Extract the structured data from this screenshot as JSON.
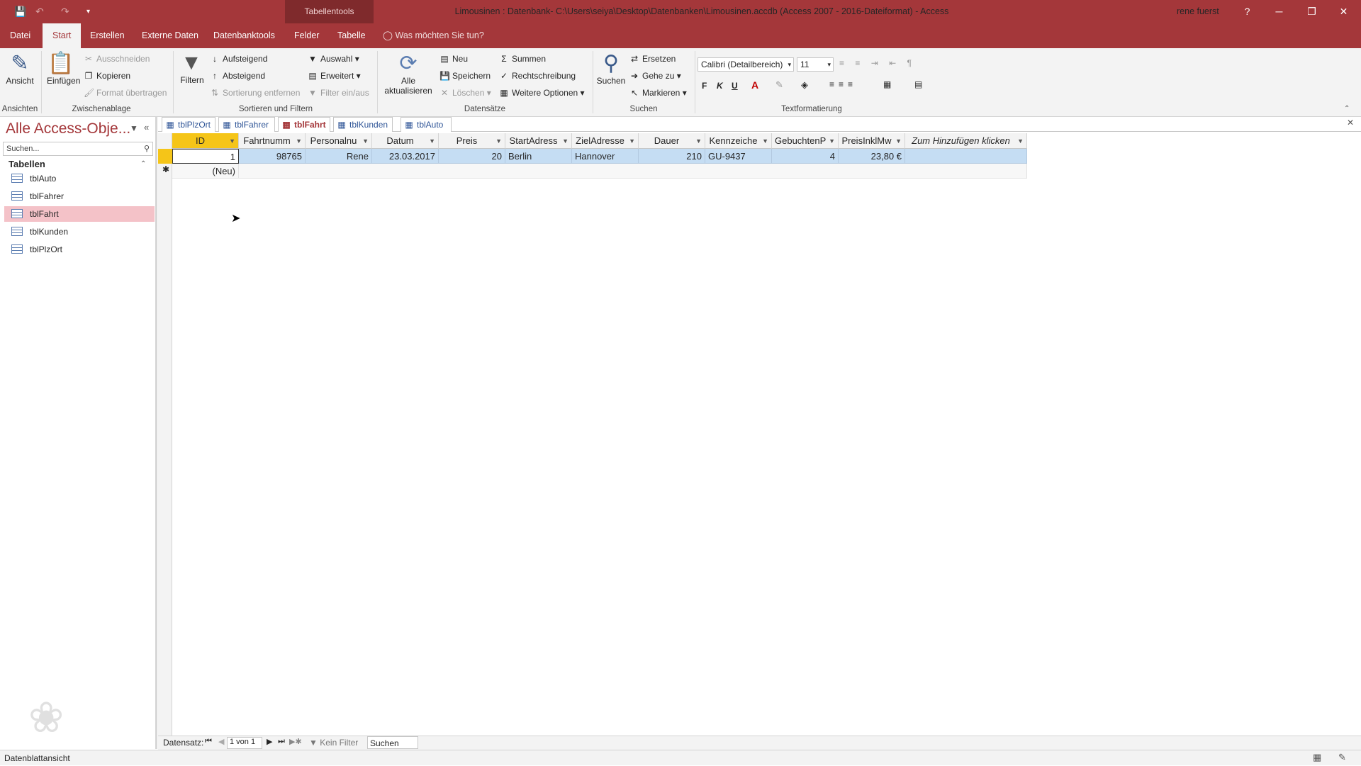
{
  "titlebar": {
    "context_label": "Tabellentools",
    "title": "Limousinen : Datenbank- C:\\Users\\seiya\\Desktop\\Datenbanken\\Limousinen.accdb (Access 2007 - 2016-Dateiformat)  -  Access",
    "user": "rene fuerst",
    "help": "?",
    "minimize": "─",
    "restore": "❐",
    "close": "✕"
  },
  "ribbon_tabs": [
    "Datei",
    "Start",
    "Erstellen",
    "Externe Daten",
    "Datenbanktools",
    "Felder",
    "Tabelle"
  ],
  "tell_me": "Was möchten Sie tun?",
  "ribbon": {
    "ansichten": {
      "label": "Ansichten",
      "ansicht": "Ansicht"
    },
    "zwischenablage": {
      "label": "Zwischenablage",
      "einfuegen": "Einfügen",
      "ausschneiden": "Ausschneiden",
      "kopieren": "Kopieren",
      "format": "Format übertragen"
    },
    "sortieren": {
      "label": "Sortieren und Filtern",
      "filtern": "Filtern",
      "aufsteigend": "Aufsteigend",
      "absteigend": "Absteigend",
      "sortierung_entfernen": "Sortierung entfernen",
      "auswahl": "Auswahl",
      "erweitert": "Erweitert",
      "filter_einaus": "Filter ein/aus"
    },
    "datensaetze": {
      "label": "Datensätze",
      "alle": "Alle",
      "aktualisieren": "aktualisieren",
      "neu": "Neu",
      "speichern": "Speichern",
      "loeschen": "Löschen",
      "summen": "Summen",
      "rechtschreibung": "Rechtschreibung",
      "weitere": "Weitere Optionen"
    },
    "suchen": {
      "label": "Suchen",
      "suchen": "Suchen",
      "ersetzen": "Ersetzen",
      "gehe_zu": "Gehe zu",
      "markieren": "Markieren"
    },
    "text": {
      "label": "Textformatierung",
      "font": "Calibri (Detailbereich)",
      "size": "11",
      "bold": "F",
      "italic": "K",
      "underline": "U"
    }
  },
  "nav_pane": {
    "title": "Alle Access-Obje...",
    "search_placeholder": "Suchen...",
    "section": "Tabellen",
    "items": [
      "tblAuto",
      "tblFahrer",
      "tblFahrt",
      "tblKunden",
      "tblPlzOrt"
    ],
    "selected": "tblFahrt"
  },
  "doc_tabs": [
    "tblPlzOrt",
    "tblFahrer",
    "tblFahrt",
    "tblKunden",
    "tblAuto"
  ],
  "active_doc_tab": "tblFahrt",
  "datasheet": {
    "columns": [
      "ID",
      "Fahrtnumm",
      "Personalnu",
      "Datum",
      "Preis",
      "StartAdress",
      "ZielAdresse",
      "Dauer",
      "Kennzeiche",
      "GebuchtenP",
      "PreisInklMw",
      "Zum Hinzufügen klicken"
    ],
    "rows": [
      [
        "1",
        "98765",
        "Rene",
        "23.03.2017",
        "20",
        "Berlin",
        "Hannover",
        "210",
        "GU-9437",
        "4",
        "23,80 €",
        ""
      ]
    ],
    "new_row_label": "(Neu)",
    "new_marker": "✱"
  },
  "record_nav": {
    "label": "Datensatz:",
    "position": "1 von 1",
    "filter": "Kein Filter",
    "search": "Suchen"
  },
  "status": {
    "left": "Datenblattansicht"
  },
  "colors": {
    "accent": "#a4373a",
    "selected_row": "#c5ddf3",
    "nav_selected": "#f4c2c8",
    "id_header": "#f5c518"
  }
}
